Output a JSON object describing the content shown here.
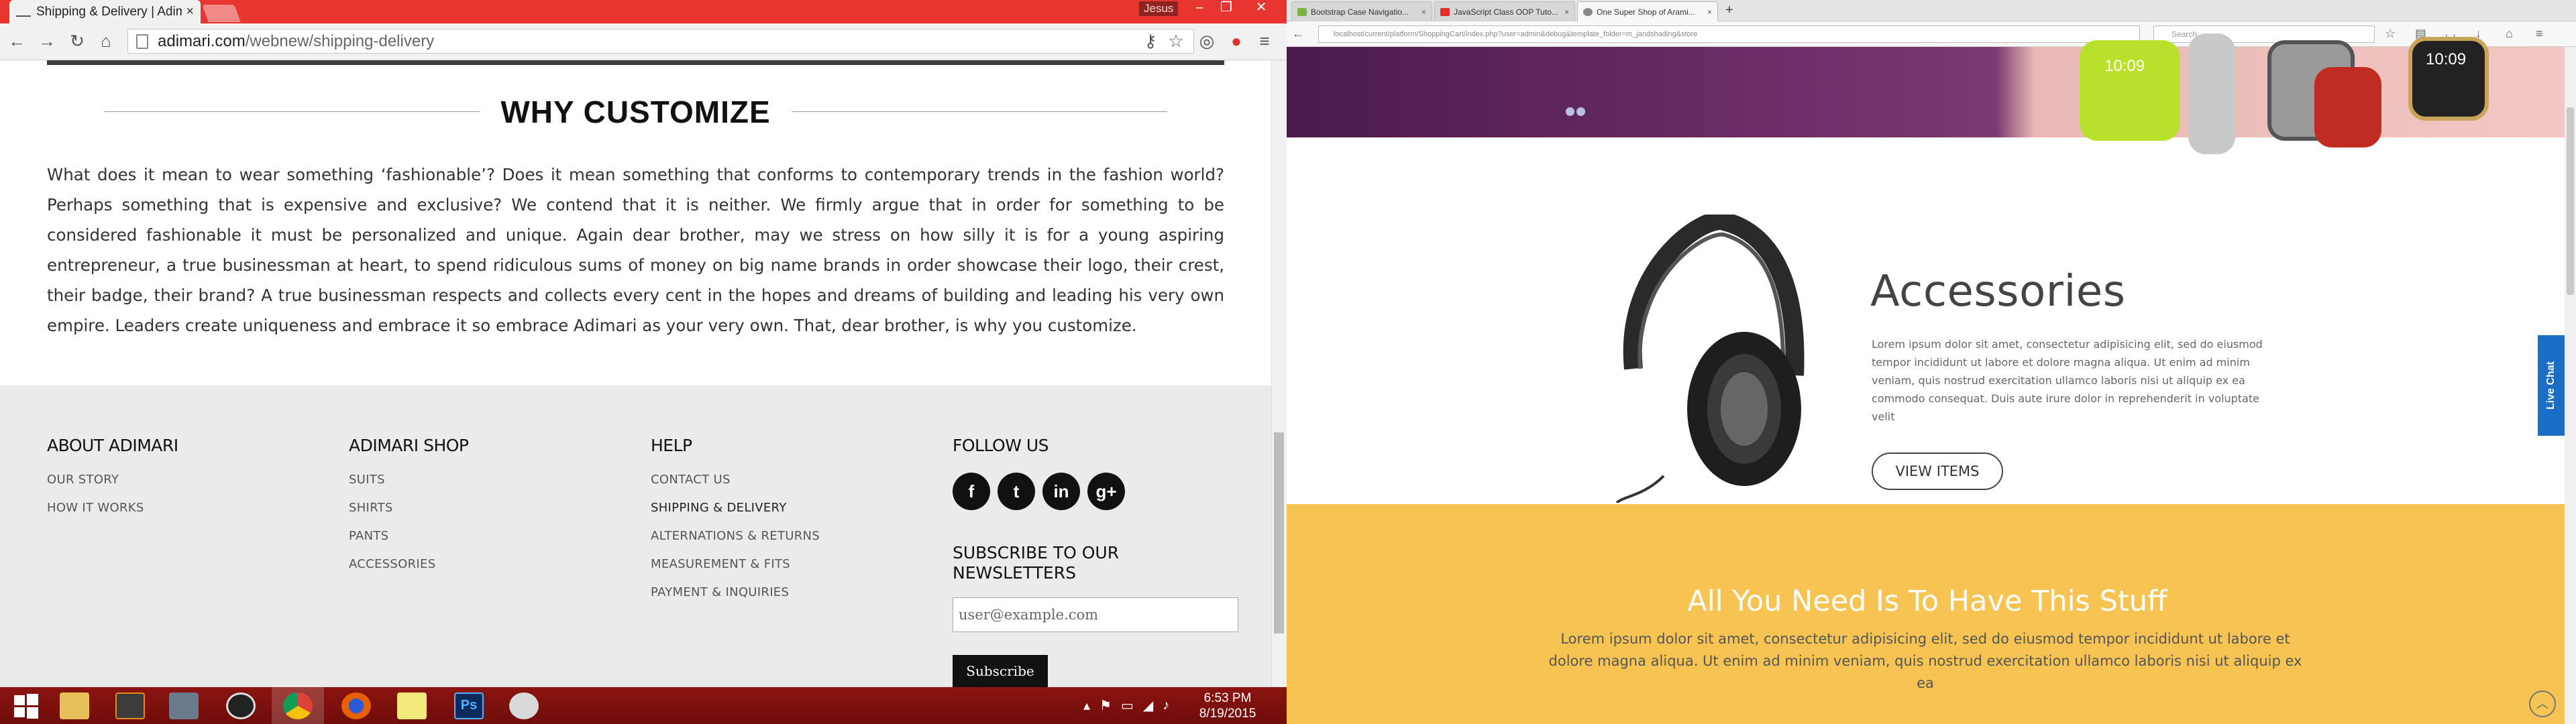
{
  "left_window": {
    "tab_title": "Shipping & Delivery | Adimari",
    "user_badge": "Jesus",
    "url_domain": "adimari.com",
    "url_path": "/webnew/shipping-delivery",
    "section_title": "WHY CUSTOMIZE",
    "section_body": "What does it mean to wear something ‘fashionable’? Does it mean something that conforms to contemporary trends in the fashion world? Perhaps something that is expensive and exclusive? We contend that it is neither. We firmly argue that in order for something to be considered fashionable it must be personalized and unique. Again dear brother, may we stress on how silly it is for a young aspiring entrepreneur, a true businessman at heart, to spend ridiculous sums of money on big name brands in order showcase their logo, their crest, their badge, their brand? A true businessman respects and collects every cent in the hopes and dreams of building and leading his very own empire. Leaders create uniqueness and embrace it so embrace Adimari as your very own. That, dear brother, is why you customize.",
    "footer": {
      "about": {
        "heading": "ABOUT ADIMARI",
        "links": [
          "OUR STORY",
          "HOW IT WORKS"
        ]
      },
      "shop": {
        "heading": "ADIMARI SHOP",
        "links": [
          "SUITS",
          "SHIRTS",
          "PANTS",
          "ACCESSORIES"
        ]
      },
      "help": {
        "heading": "HELP",
        "links": [
          "CONTACT US",
          "SHIPPING & DELIVERY",
          "ALTERNATIONS & RETURNS",
          "MEASUREMENT & FITS",
          "PAYMENT & INQUIRIES"
        ]
      },
      "follow": {
        "heading": "FOLLOW US",
        "icons": [
          "facebook-icon",
          "twitter-icon",
          "linkedin-icon",
          "googleplus-icon"
        ]
      },
      "subscribe": {
        "heading": "SUBSCRIBE TO OUR NEWSLETTERS",
        "placeholder": "user@example.com",
        "button": "Subscribe"
      }
    }
  },
  "taskbar": {
    "time": "6:53 PM",
    "date": "8/19/2015",
    "apps": [
      "start",
      "file-explorer",
      "sublime-text",
      "taskbar-app",
      "clock-app",
      "chrome",
      "firefox",
      "sticky-notes",
      "photoshop",
      "paint"
    ]
  },
  "right_window": {
    "tabs": [
      "Bootstrap Case Navigatio...",
      "JavaScript Class OOP Tuto...",
      "One Super Shop of Arami..."
    ],
    "url": "localhost/current/platform/ShoppingCart/index.php?user=admin&debug&template_folder=m_jandshading&store",
    "search_placeholder": "Search",
    "accessories_title": "Accessories",
    "accessories_body": "Lorem ipsum dolor sit amet, consectetur adipisicing elit, sed do eiusmod tempor incididunt ut labore et dolore magna aliqua. Ut enim ad minim veniam, quis nostrud exercitation ullamco laboris nisi ut aliquip ex ea commodo consequat. Duis aute irure dolor in reprehenderit in voluptate velit",
    "view_items": "VIEW ITEMS",
    "banner_title": "All You Need Is To Have This Stuff",
    "banner_body": "Lorem ipsum dolor sit amet, consectetur adipisicing elit, sed do eiusmod tempor incididunt ut labore et dolore magna aliqua. Ut enim ad minim veniam, quis nostrud exercitation ullamco laboris nisi ut aliquip ex ea",
    "live_chat": "Live Chat",
    "watch_time": "10:09"
  },
  "colors": {
    "chrome_titlebar": "#e8352f",
    "taskbar": "#8b1410",
    "hero_purple": "#6e2f6a",
    "banner_yellow": "#f7c453",
    "live_chat_blue": "#1a6ec7"
  }
}
